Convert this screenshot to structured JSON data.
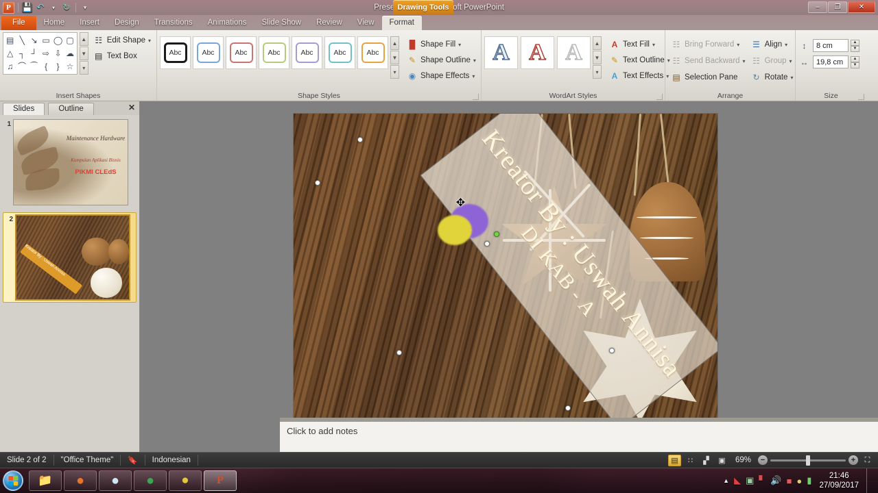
{
  "window": {
    "title": "Presentation1  -  Microsoft PowerPoint",
    "contextual_tab": "Drawing Tools",
    "minimize_label": "–",
    "restore_label": "❐",
    "close_label": "✕"
  },
  "quick_access": {
    "app_icon": "powerpoint-logo",
    "items": [
      {
        "name": "save-icon",
        "glyph": "💾"
      },
      {
        "name": "undo-icon",
        "glyph": "↶"
      },
      {
        "name": "undo-dropdown-icon",
        "glyph": "▾"
      },
      {
        "name": "redo-icon",
        "glyph": "↻"
      },
      {
        "name": "customize-qat-icon",
        "glyph": "☰"
      }
    ]
  },
  "tabs": [
    {
      "label": "File",
      "state": "file"
    },
    {
      "label": "Home",
      "state": "normal"
    },
    {
      "label": "Insert",
      "state": "normal"
    },
    {
      "label": "Design",
      "state": "normal"
    },
    {
      "label": "Transitions",
      "state": "normal"
    },
    {
      "label": "Animations",
      "state": "normal"
    },
    {
      "label": "Slide Show",
      "state": "normal"
    },
    {
      "label": "Review",
      "state": "normal"
    },
    {
      "label": "View",
      "state": "normal"
    },
    {
      "label": "Format",
      "state": "active"
    }
  ],
  "ribbon": {
    "groups": [
      {
        "name": "Insert Shapes"
      },
      {
        "name": "Shape Styles"
      },
      {
        "name": "WordArt Styles"
      },
      {
        "name": "Arrange"
      },
      {
        "name": "Size"
      }
    ],
    "insert_shapes": {
      "shapes": [
        "▤",
        "╲",
        "↘",
        "▭",
        "◯",
        "▢",
        "△",
        "┐",
        "┘",
        "⇨",
        "⇩",
        "☁",
        "♫",
        "⌒",
        "⁀",
        "{",
        "}",
        "☆"
      ],
      "edit_shape": "Edit Shape",
      "text_box": "Text Box",
      "edit_shape_icon": "edit-shape-icon",
      "text_box_icon": "text-box-icon"
    },
    "shape_styles": {
      "thumb_label": "Abc",
      "swatches": [
        "#1a1a1a",
        "#7aa6d8",
        "#c9746f",
        "#b4cc77",
        "#a79bd0",
        "#6fc0c8",
        "#e8a33d"
      ],
      "selected_index": 0,
      "shape_fill": "Shape Fill",
      "shape_outline": "Shape Outline",
      "shape_effects": "Shape Effects"
    },
    "wordart_styles": {
      "glyph": "A",
      "swatches": [
        "#4f6f95",
        "#b0403a",
        "#b9b9b9"
      ],
      "text_fill": "Text Fill",
      "text_outline": "Text Outline",
      "text_effects": "Text Effects"
    },
    "arrange": {
      "bring_forward": "Bring Forward",
      "send_backward": "Send Backward",
      "selection_pane": "Selection Pane",
      "align": "Align",
      "group": "Group",
      "rotate": "Rotate"
    },
    "size": {
      "height_label": "shape-height",
      "height_value": "8 cm",
      "width_label": "shape-width",
      "width_value": "19,8 cm"
    }
  },
  "slide_pane": {
    "tabs": [
      {
        "label": "Slides",
        "active": true
      },
      {
        "label": "Outline",
        "active": false
      }
    ],
    "close_label": "✕",
    "slides": [
      {
        "number": "1",
        "selected": false,
        "title": "Maintenance Hardware",
        "subtitle": "Kumpulan Aplikasi Bisnis",
        "brand": "PIKMI CLEdS"
      },
      {
        "number": "2",
        "selected": true,
        "banner_text": "Kreator By : Uswah Annisa"
      }
    ]
  },
  "slide": {
    "shape_text_line1": "Kreator By : Uswah Annisa",
    "shape_text_line2": "DI KAB - A",
    "cursor": "move-cursor"
  },
  "notes": {
    "placeholder": "Click to add notes"
  },
  "status_bar": {
    "slide_counter": "Slide 2 of 2",
    "theme": "\"Office Theme\"",
    "spellcheck_icon": "spellcheck-icon",
    "language": "Indonesian",
    "views": [
      {
        "name": "normal-view-button",
        "glyph": "▤",
        "active": true
      },
      {
        "name": "slide-sorter-button",
        "glyph": "∷",
        "active": false
      },
      {
        "name": "reading-view-button",
        "glyph": "▞",
        "active": false
      },
      {
        "name": "slide-show-button",
        "glyph": "▣",
        "active": false
      }
    ],
    "zoom_level": "69%",
    "zoom_out": "−",
    "zoom_in": "+",
    "fit_to_window_icon": "fit-slide-icon"
  },
  "taskbar": {
    "start_label": "start-orb",
    "buttons": [
      {
        "name": "taskbar-windows-explorer",
        "glyph": "📁",
        "active": false
      },
      {
        "name": "taskbar-firefox",
        "glyph": "●",
        "active": false
      },
      {
        "name": "taskbar-internet-explorer",
        "glyph": "●",
        "active": false
      },
      {
        "name": "taskbar-chrome",
        "glyph": "●",
        "active": false
      },
      {
        "name": "taskbar-media-player",
        "glyph": "▶",
        "active": false
      },
      {
        "name": "taskbar-powerpoint",
        "glyph": "P",
        "active": true
      }
    ],
    "tray": [
      {
        "name": "show-hidden-icons",
        "glyph": "▲"
      },
      {
        "name": "antivirus-icon",
        "glyph": "◢"
      },
      {
        "name": "network-monitor-icon",
        "glyph": "▣"
      },
      {
        "name": "signal-icon",
        "glyph": "▃"
      },
      {
        "name": "volume-icon",
        "glyph": "🔊"
      },
      {
        "name": "usb-safely-remove-icon",
        "glyph": "■"
      },
      {
        "name": "updater-icon",
        "glyph": "●"
      },
      {
        "name": "battery-icon",
        "glyph": "▮"
      }
    ],
    "clock_time": "21:46",
    "clock_date": "27/09/2017"
  }
}
